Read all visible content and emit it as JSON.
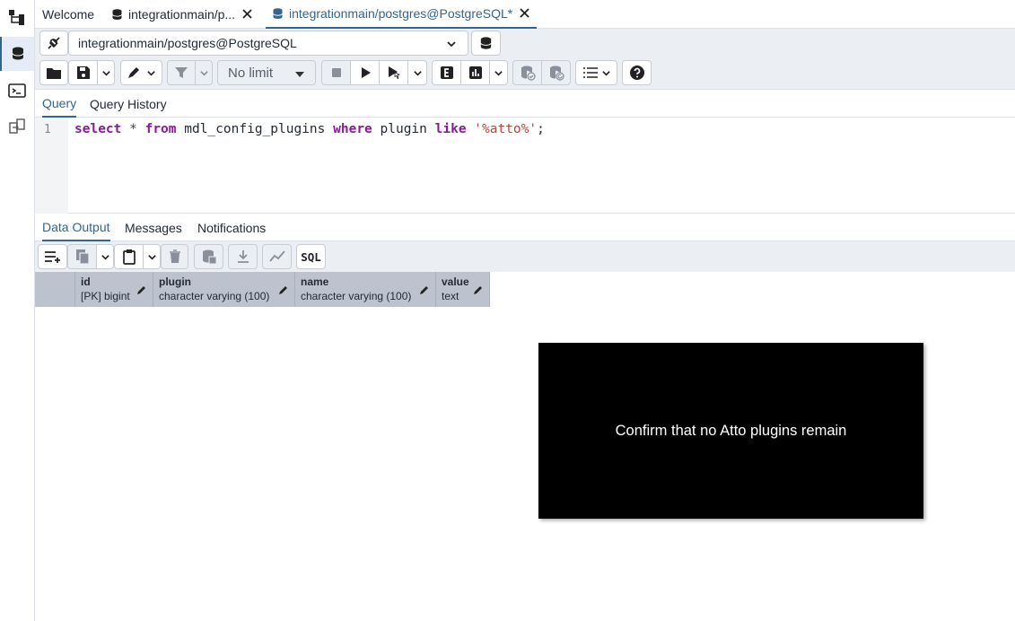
{
  "sidebar": {
    "items": [
      {
        "icon": "object-explorer-icon"
      },
      {
        "icon": "query-tool-icon"
      },
      {
        "icon": "psql-terminal-icon"
      },
      {
        "icon": "schema-diff-icon"
      }
    ]
  },
  "tabs": [
    {
      "label": "Welcome"
    },
    {
      "label": "integrationmain/p...",
      "icon": "database-icon"
    },
    {
      "label": "integrationmain/postgres@PostgreSQL*",
      "icon": "database-icon"
    }
  ],
  "connection": {
    "label": "integrationmain/postgres@PostgreSQL"
  },
  "toolbar": {
    "limit_label": "No limit"
  },
  "query_tabs": [
    {
      "label": "Query"
    },
    {
      "label": "Query History"
    }
  ],
  "editor": {
    "line_number": "1",
    "tokens": {
      "select": "select",
      "star": " * ",
      "from": "from",
      "table": " mdl_config_plugins ",
      "where": "where",
      "column": " plugin ",
      "like": "like",
      "space": " ",
      "pattern": "'%atto%'",
      "semi": ";"
    }
  },
  "output_tabs": [
    {
      "label": "Data Output"
    },
    {
      "label": "Messages"
    },
    {
      "label": "Notifications"
    }
  ],
  "output_toolbar": {
    "sql_label": "SQL"
  },
  "columns": [
    {
      "name": "id",
      "type": "[PK] bigint"
    },
    {
      "name": "plugin",
      "type": "character varying (100)"
    },
    {
      "name": "name",
      "type": "character varying (100)"
    },
    {
      "name": "value",
      "type": "text"
    }
  ],
  "overlay": {
    "text": "Confirm that no Atto plugins remain"
  },
  "colors": {
    "accent": "#326690",
    "toolbar_bg": "#ebeef3",
    "header_bg": "#bcc3ce"
  }
}
